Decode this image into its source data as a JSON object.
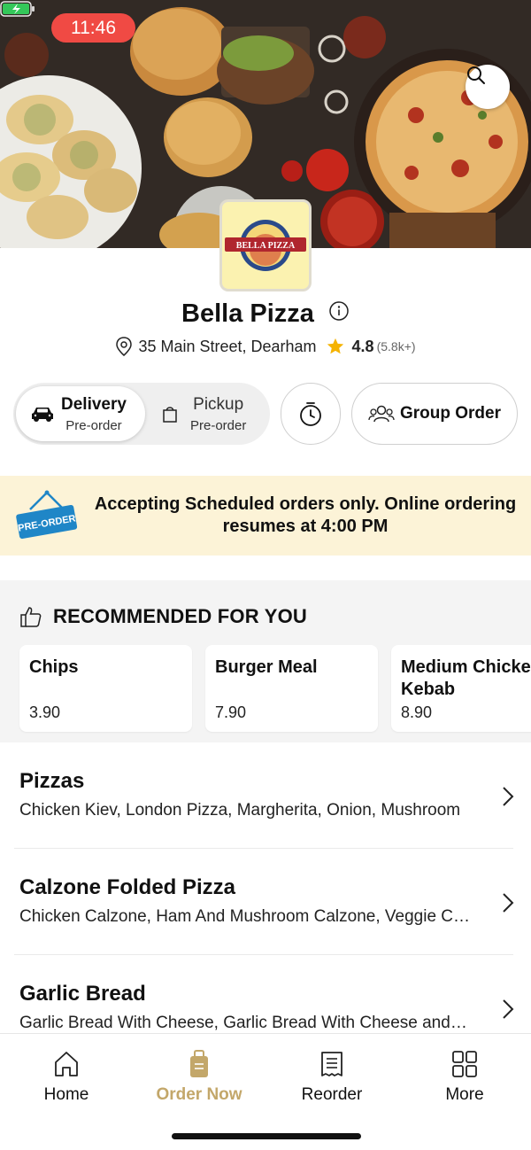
{
  "status_bar": {
    "time": "11:46"
  },
  "store": {
    "name": "Bella Pizza",
    "logo_text": "BELLA PIZZA",
    "address": "35 Main Street, Dearham",
    "rating": "4.8",
    "rating_count": "(5.8k+)"
  },
  "order_mode": {
    "delivery": {
      "label": "Delivery",
      "sub": "Pre-order"
    },
    "pickup": {
      "label": "Pickup",
      "sub": "Pre-order"
    },
    "group_order_label": "Group Order"
  },
  "banner": {
    "tag": "PRE-ORDER",
    "message": "Accepting Scheduled orders only. Online ordering resumes at 4:00 PM"
  },
  "recommended": {
    "title": "RECOMMENDED FOR YOU",
    "items": [
      {
        "name": "Chips",
        "price": "3.90"
      },
      {
        "name": "Burger Meal",
        "price": "7.90"
      },
      {
        "name": "Medium Chicken Kebab",
        "price": "8.90"
      }
    ]
  },
  "categories": [
    {
      "name": "Pizzas",
      "desc": "Chicken Kiev, London Pizza, Margherita, Onion, Mushroom"
    },
    {
      "name": "Calzone Folded Pizza",
      "desc": "Chicken Calzone, Ham And Mushroom Calzone, Veggie Calzone"
    },
    {
      "name": "Garlic Bread",
      "desc": "Garlic Bread With Cheese, Garlic Bread With Cheese and Tomato"
    }
  ],
  "bottom_nav": [
    {
      "label": "Home",
      "icon": "home-icon"
    },
    {
      "label": "Order Now",
      "icon": "order-bag-icon"
    },
    {
      "label": "Reorder",
      "icon": "receipt-icon"
    },
    {
      "label": "More",
      "icon": "grid-icon"
    }
  ],
  "colors": {
    "accent": "#c3a76a",
    "banner_bg": "#fcf3d7",
    "time_pill": "#f04a44",
    "star": "#f5b301",
    "tag_blue": "#1f86c7"
  }
}
